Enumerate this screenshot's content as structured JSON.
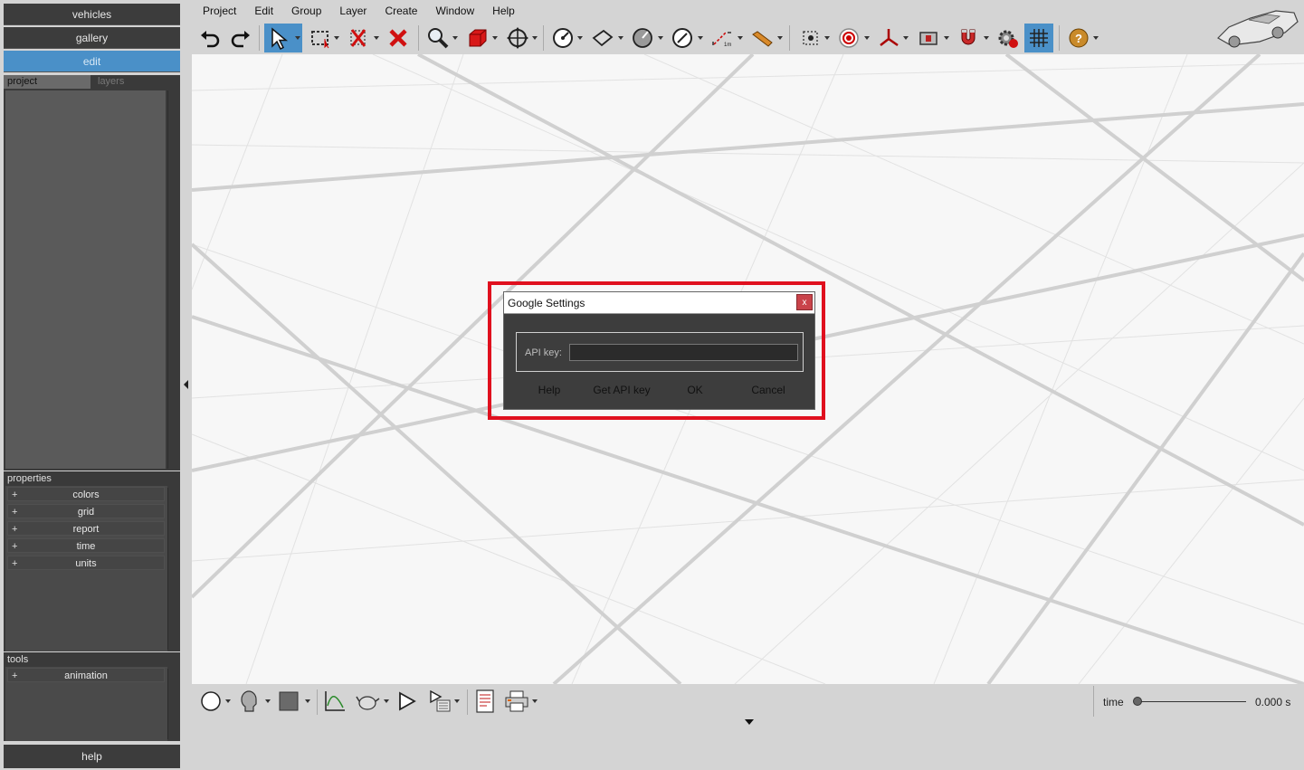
{
  "sidebar": {
    "nav": [
      "vehicles",
      "gallery",
      "edit"
    ],
    "active": "edit",
    "tabs": {
      "project": "project",
      "layers": "layers"
    },
    "properties_header": "properties",
    "properties_items": [
      "colors",
      "grid",
      "report",
      "time",
      "units"
    ],
    "tools_header": "tools",
    "tools_items": [
      "animation"
    ],
    "expand_symbol": "+",
    "help_label": "help"
  },
  "menu": [
    "Project",
    "Edit",
    "Group",
    "Layer",
    "Create",
    "Window",
    "Help"
  ],
  "toolbar": {
    "icons": [
      "undo-icon",
      "redo-icon",
      "select-icon",
      "rectangle-select-icon",
      "delete-multiple-icon",
      "delete-icon",
      "zoom-icon",
      "cube-icon",
      "move-icon",
      "rotate-circle-icon",
      "plane-icon",
      "disk-icon",
      "protractor-icon",
      "measure-icon",
      "ruler-icon",
      "target-icon",
      "record-icon",
      "axes-icon",
      "camera-icon",
      "magnet-icon",
      "settings-icon",
      "grid-icon",
      "help-icon"
    ],
    "measure_tag": "1m"
  },
  "bottom": {
    "time_label": "time",
    "time_value": "0.000 s",
    "time_fraction": 0.0
  },
  "dialog": {
    "title": "Google Settings",
    "close": "x",
    "api_label": "API key:",
    "api_value": "",
    "buttons": {
      "help": "Help",
      "get_key": "Get API key",
      "ok": "OK",
      "cancel": "Cancel"
    }
  },
  "colors": {
    "accent": "#4a90c8",
    "highlight": "#e0101e",
    "close_button": "#c9434a"
  }
}
